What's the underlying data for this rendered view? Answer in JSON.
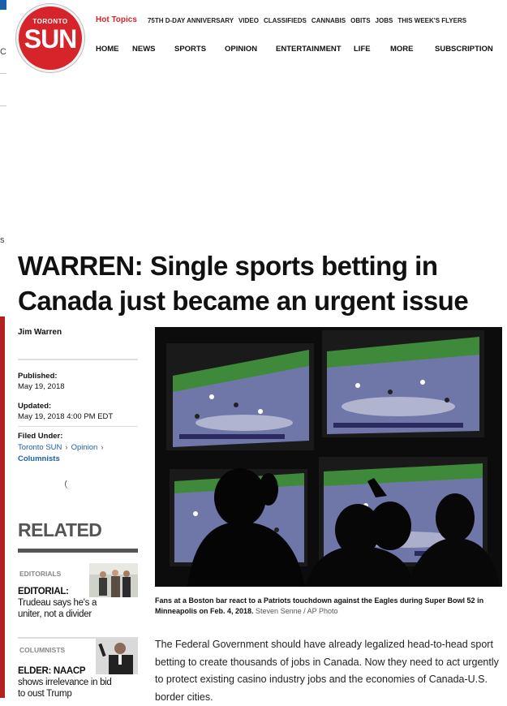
{
  "logo": {
    "line1": "TORONTO",
    "line2": "SUN"
  },
  "hot_topics": {
    "label": "Hot Topics",
    "items": [
      "75TH D-DAY ANNIVERSARY",
      "VIDEO",
      "CLASSIFIEDS",
      "CANNABIS",
      "OBITS",
      "JOBS",
      "THIS WEEK'S FLYERS"
    ]
  },
  "nav": [
    "HOME",
    "NEWS",
    "SPORTS",
    "OPINION",
    "ENTERTAINMENT",
    "LIFE",
    "MORE",
    "SUBSCRIPTION"
  ],
  "left_strip": {
    "chars": [
      "C",
      "s"
    ]
  },
  "article": {
    "headline": "WARREN: Single sports betting in Canada just became an urgent issue",
    "author": "Jim Warren",
    "published_label": "Published:",
    "published_value": "May 19, 2018",
    "updated_label": "Updated:",
    "updated_value": "May 19, 2018 4:00 PM EDT",
    "filed_label": "Filed Under:",
    "filed": [
      "Toronto SUN",
      "Opinion",
      "Columnists"
    ],
    "caption": "Fans at a Boston bar react to a Patriots touchdown against the Eagles during Super Bowl 52 in Minneapolis on Feb. 4, 2018.",
    "credit": "Steven Senne / AP Photo",
    "body": "The Federal Government should have already legalized head-to-head sport betting to create thousands of jobs in Canada. Now they need to act urgently to protect existing casino industry jobs and the economies of Canada-U.S. border cities."
  },
  "related": {
    "title": "RELATED",
    "items": [
      {
        "category": "EDITORIALS",
        "title_bold": "EDITORIAL:",
        "title_rest": "Trudeau says he's a uniter, not a divider"
      },
      {
        "category": "COLUMNISTS",
        "title_bold": "ELDER: NAACP",
        "title_rest": "shows irrelevance in bid to oust Trump"
      }
    ]
  },
  "colors": {
    "brand_red": "#d6242a",
    "link_blue": "#1b5fa8"
  }
}
